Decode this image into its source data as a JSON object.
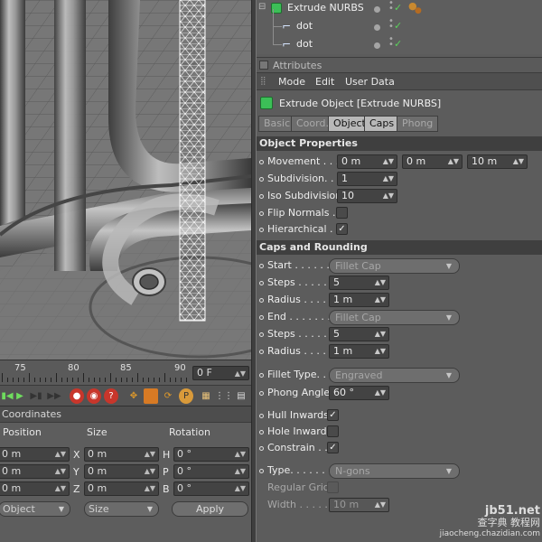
{
  "object_manager": {
    "items": [
      {
        "name": "Extrude NURBS",
        "level": 0
      },
      {
        "name": "dot",
        "level": 1
      },
      {
        "name": "dot",
        "level": 1
      }
    ]
  },
  "attributes": {
    "title": "Attributes",
    "menu": [
      "Mode",
      "Edit",
      "User Data"
    ],
    "object_title": "Extrude Object [Extrude NURBS]",
    "tabs": [
      {
        "label": "Basic",
        "active": false
      },
      {
        "label": "Coord.",
        "active": false
      },
      {
        "label": "Object",
        "active": true
      },
      {
        "label": "Caps",
        "active": true
      },
      {
        "label": "Phong",
        "active": false
      }
    ],
    "object_properties": {
      "heading": "Object Properties",
      "movement_label": "Movement . . .",
      "movement": [
        "0 m",
        "0 m",
        "10 m"
      ],
      "subdivision_label": "Subdivision. . .",
      "subdivision": "1",
      "iso_subdivision_label": "Iso Subdivision",
      "iso_subdivision": "10",
      "flip_normals_label": "Flip Normals . .",
      "flip_normals": false,
      "hierarchical_label": "Hierarchical . .",
      "hierarchical": true
    },
    "caps": {
      "heading": "Caps and Rounding",
      "start_label": "Start . . . . . . .",
      "start": "Fillet Cap",
      "steps1_label": "Steps . . . . . . .",
      "steps1": "5",
      "radius1_label": "Radius . . . . . .",
      "radius1": "1 m",
      "end_label": "End . . . . . . . .",
      "end": "Fillet Cap",
      "steps2_label": "Steps . . . . . . .",
      "steps2": "5",
      "radius2_label": "Radius . . . . . .",
      "radius2": "1 m",
      "fillet_type_label": "Fillet Type. . . .",
      "fillet_type": "Engraved",
      "phong_angle_label": "Phong Angle",
      "phong_angle": "60 °",
      "hull_inwards_label": "Hull Inwards",
      "hull_inwards": true,
      "hole_inwards_label": "Hole Inwards",
      "hole_inwards": false,
      "constrain_label": "Constrain . .",
      "constrain": true,
      "type_label": "Type. . . . . . . .",
      "type": "N-gons",
      "regular_grid_label": "Regular Grid",
      "regular_grid": false,
      "width_label": "Width . . . . . .",
      "width": "10 m"
    }
  },
  "timeline": {
    "ticks": [
      "75",
      "80",
      "85",
      "90"
    ],
    "current_frame": "0 F"
  },
  "coordinates": {
    "title": "Coordinates",
    "headers": [
      "Position",
      "Size",
      "Rotation"
    ],
    "rows": [
      {
        "pos": "0 m",
        "axis": "X",
        "size": "0 m",
        "rot_axis": "H",
        "rot": "0 °"
      },
      {
        "pos": "0 m",
        "axis": "Y",
        "size": "0 m",
        "rot_axis": "P",
        "rot": "0 °"
      },
      {
        "pos": "0 m",
        "axis": "Z",
        "size": "0 m",
        "rot_axis": "B",
        "rot": "0 °"
      }
    ],
    "mode_dropdown": "Object",
    "size_dropdown": "Size",
    "apply_label": "Apply"
  },
  "watermark": {
    "line1": "jb51.net",
    "line2": "查字典 教程网",
    "line3": "jiaocheng.chazidian.com"
  },
  "colors": {
    "panel_bg": "#5e5e5e",
    "section_bg": "#3f3f3f",
    "active_tab": "#b8b8b8",
    "check_green": "#5bd15b",
    "record_red": "#c8362b"
  }
}
